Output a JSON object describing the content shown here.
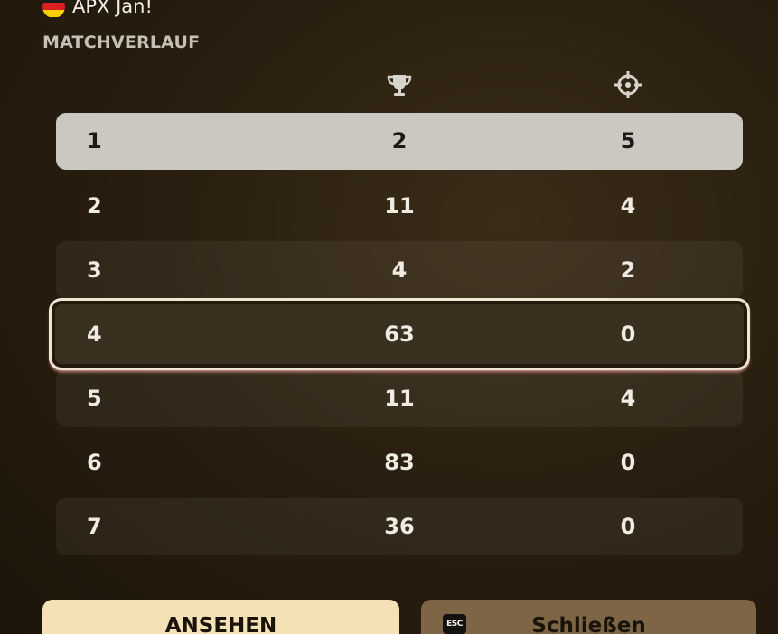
{
  "player": {
    "name": "APX Jan!",
    "flag_colors": [
      "#1a1a1a",
      "#dd1f1f",
      "#ffce00"
    ]
  },
  "section_title": "MATCHVERLAUF",
  "columns": {
    "col2_icon": "trophy-icon",
    "col3_icon": "crosshair-icon"
  },
  "matches": [
    {
      "round": "1",
      "placement": "2",
      "kills": "5"
    },
    {
      "round": "2",
      "placement": "11",
      "kills": "4"
    },
    {
      "round": "3",
      "placement": "4",
      "kills": "2"
    },
    {
      "round": "4",
      "placement": "63",
      "kills": "0"
    },
    {
      "round": "5",
      "placement": "11",
      "kills": "4"
    },
    {
      "round": "6",
      "placement": "83",
      "kills": "0"
    },
    {
      "round": "7",
      "placement": "36",
      "kills": "0"
    }
  ],
  "buttons": {
    "view_label": "ANSEHEN",
    "close_label": "Schließen",
    "close_key": "ESC"
  }
}
